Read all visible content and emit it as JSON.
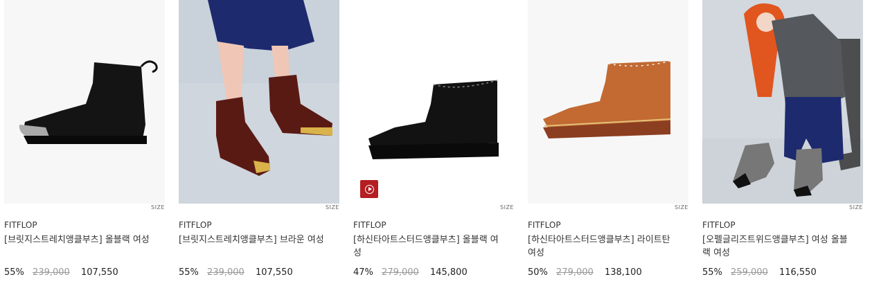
{
  "size_label": "SIZE",
  "colors": {
    "video_button": "#b51d23",
    "original_price": "#999999"
  },
  "video_icon": "play-circle-icon",
  "products": [
    {
      "brand": "FITFLOP",
      "title": "[브릿지스트레치앵클부츠] 올블랙 여성",
      "discount": "55%",
      "original_price": "239,000",
      "price": "107,550"
    },
    {
      "brand": "FITFLOP",
      "title": "[브릿지스트레치앵클부츠] 브라운 여성",
      "discount": "55%",
      "original_price": "239,000",
      "price": "107,550"
    },
    {
      "brand": "FITFLOP",
      "title": "[하신타아트스터드앵클부츠] 올블랙 여성",
      "discount": "47%",
      "original_price": "279,000",
      "price": "145,800"
    },
    {
      "brand": "FITFLOP",
      "title": "[하신타아트스터드앵클부츠] 라이트탄 여성",
      "discount": "50%",
      "original_price": "279,000",
      "price": "138,100"
    },
    {
      "brand": "FITFLOP",
      "title": "[오펠글리즈트위드앵클부츠] 여성 올블랙 여성",
      "discount": "55%",
      "original_price": "259,000",
      "price": "116,550"
    }
  ]
}
